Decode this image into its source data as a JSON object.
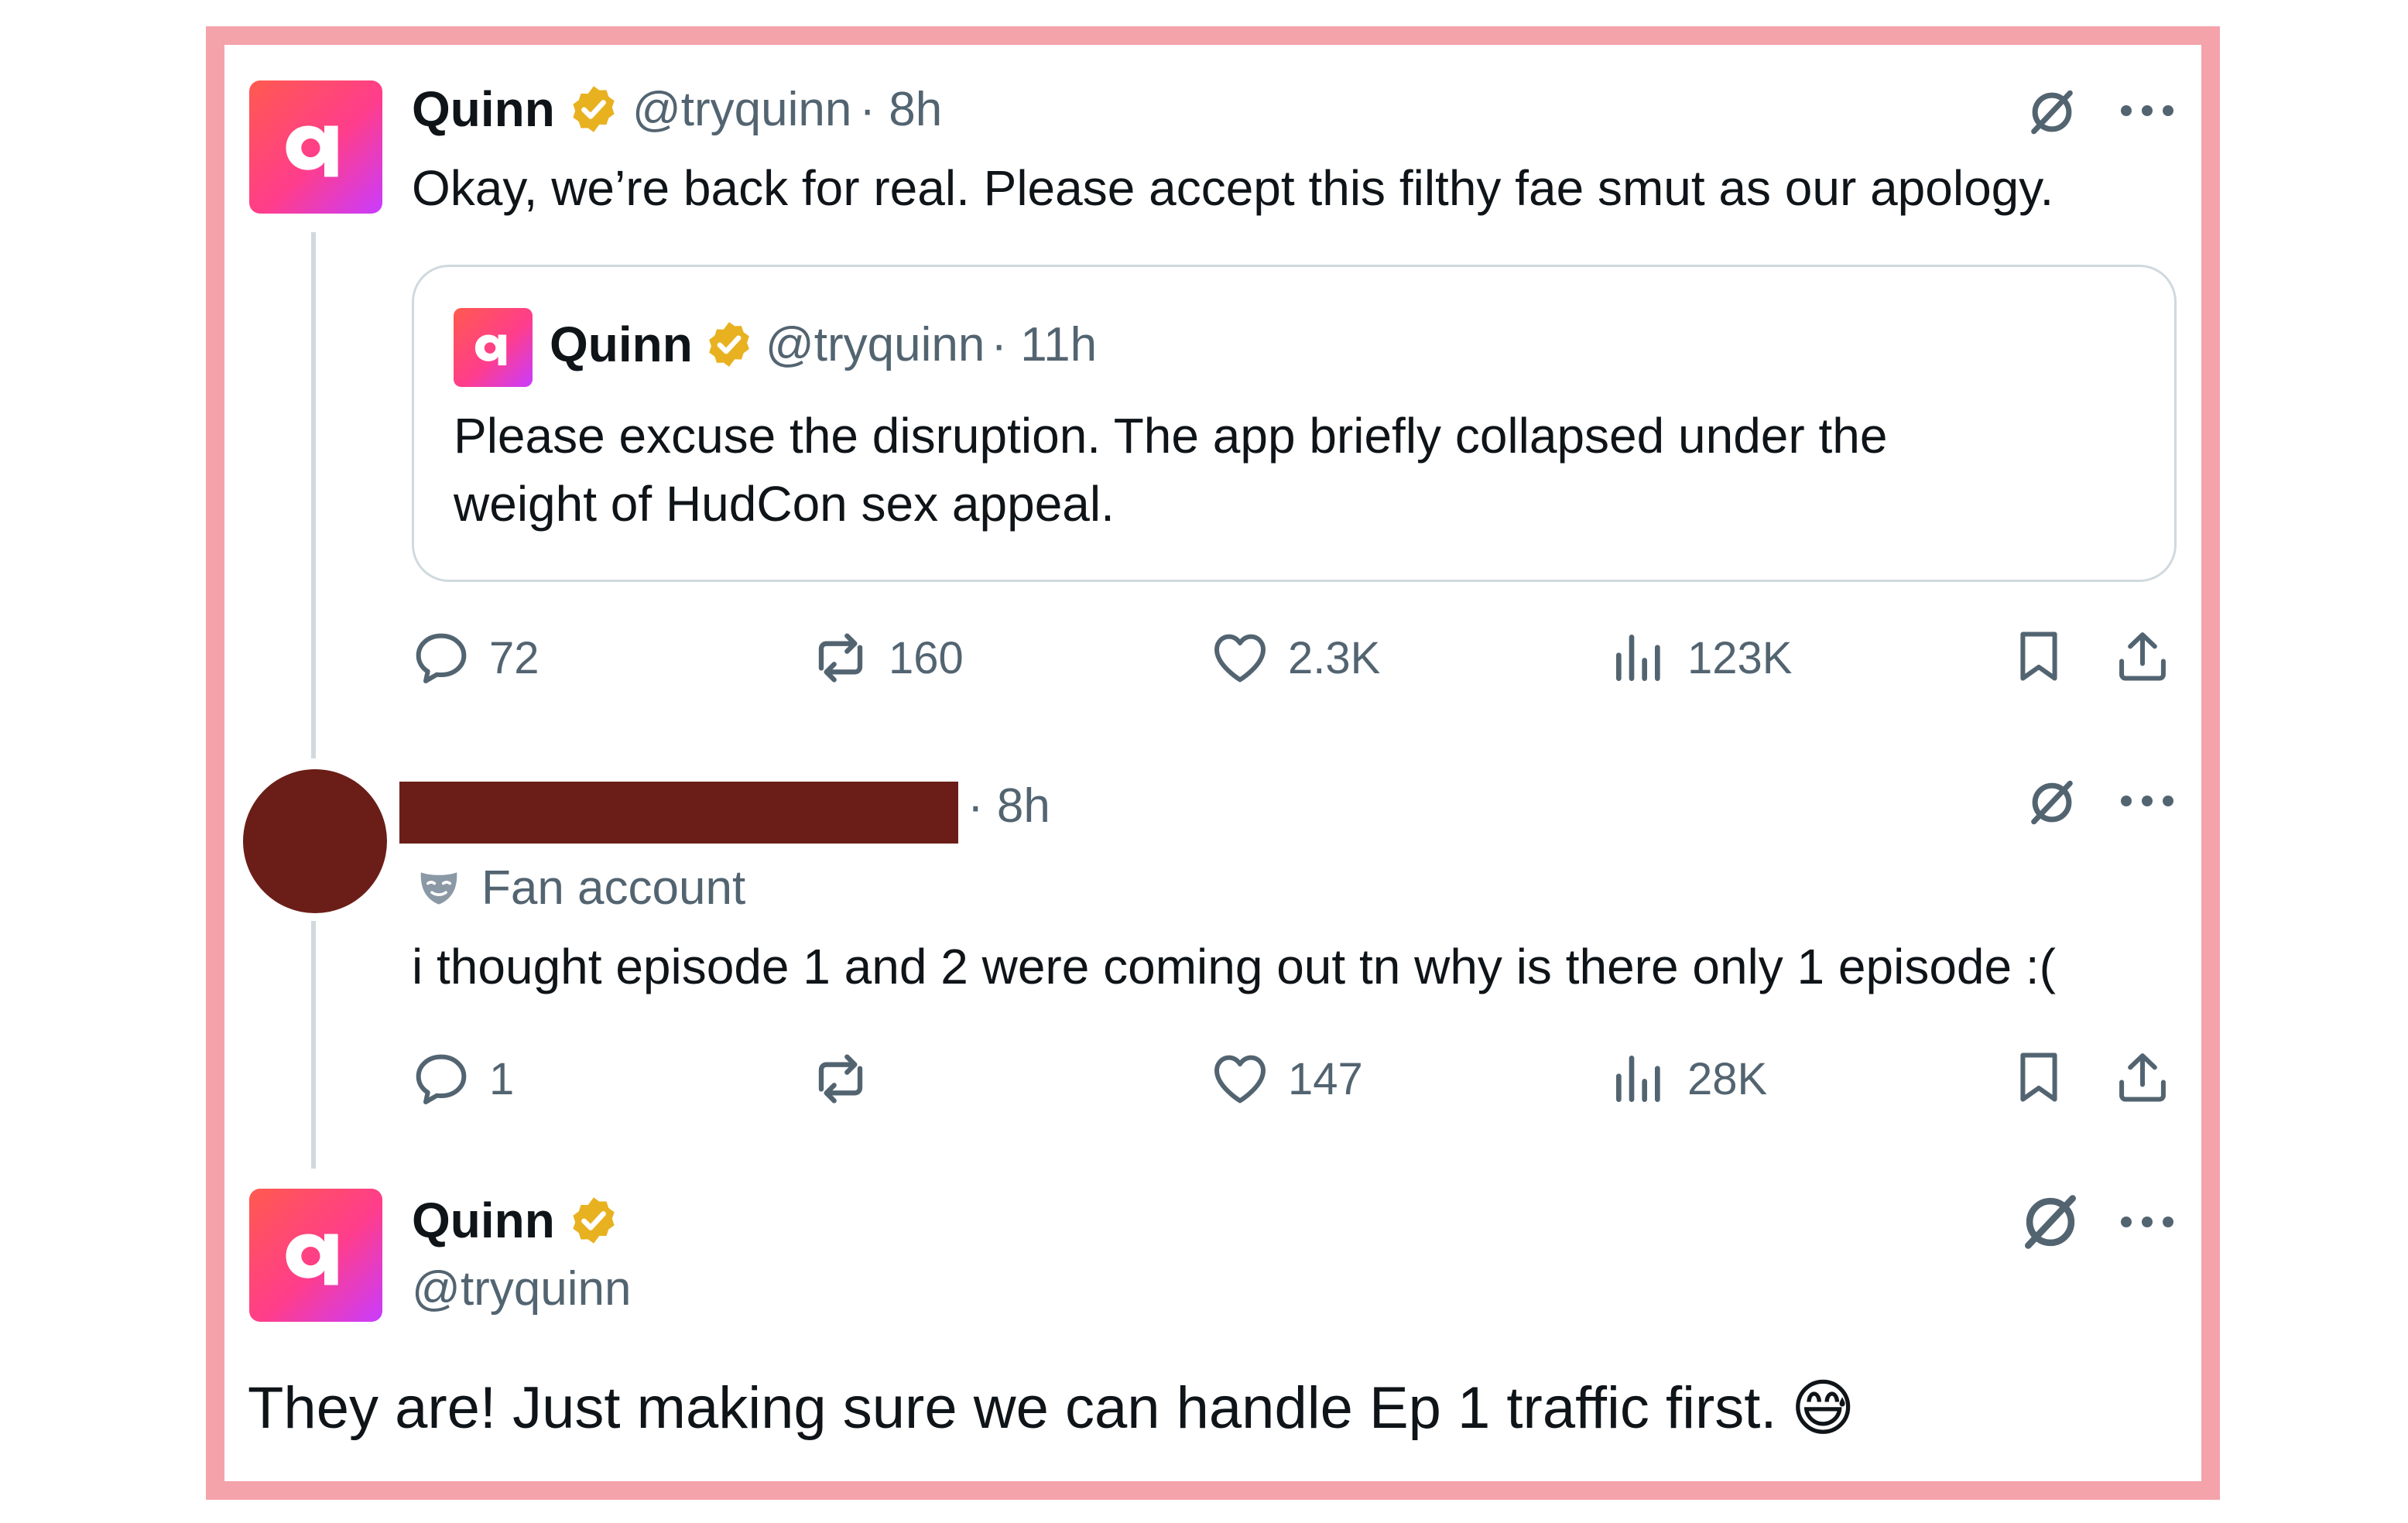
{
  "main_tweet": {
    "author_name": "Quinn",
    "handle": "@tryquinn",
    "time": "· 8h",
    "text": "Okay, we’re back for real. Please accept this filthy fae smut as our apology.",
    "quoted": {
      "author_name": "Quinn",
      "handle": "@tryquinn",
      "time": "· 11h",
      "text_line1": "Please excuse the disruption. The app briefly collapsed under the",
      "text_line2": "weight of HudCon sex appeal."
    },
    "actions": {
      "replies": "72",
      "reposts": "160",
      "likes": "2.3K",
      "views": "123K"
    }
  },
  "reply_tweet": {
    "time": "· 8h",
    "label": "Fan account",
    "text": "i thought episode 1 and 2 were coming out tn why is there only 1 episode :(",
    "actions": {
      "replies": "1",
      "reposts": "",
      "likes": "147",
      "views": "28K"
    }
  },
  "final_tweet": {
    "author_name": "Quinn",
    "handle": "@tryquinn",
    "text": "They are! Just making sure we can handle Ep 1 traffic first.",
    "emoji": "😅"
  },
  "icons": [
    "verified-badge-icon",
    "grok-icon",
    "more-icon",
    "reply-icon",
    "repost-icon",
    "like-icon",
    "views-icon",
    "bookmark-icon",
    "share-icon",
    "mask-icon"
  ],
  "colors": {
    "frame": "#f4a3ab",
    "verified": "#e8b120",
    "muted": "#536471",
    "redaction": "#6b1e18",
    "avatar_gradient": [
      "#ff5a4f",
      "#ff3d8b",
      "#c93cff"
    ]
  }
}
